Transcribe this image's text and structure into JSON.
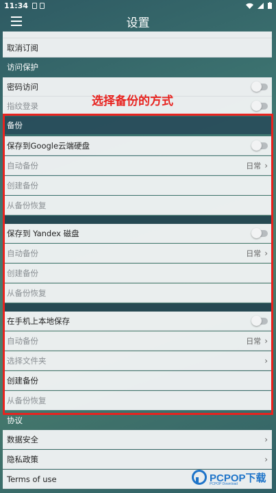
{
  "status": {
    "time": "11:34"
  },
  "app_bar": {
    "title": "设置"
  },
  "annotation": "选择备份的方式",
  "rows": {
    "cancel_subscription": "取消订阅",
    "access_header": "访问保护",
    "password_access": "密码访问",
    "fingerprint": "指纹登录",
    "backup_header": "备份",
    "google_save": "保存到Google云端硬盘",
    "auto_backup": "自动备份",
    "daily": "日常",
    "create_backup": "创建备份",
    "restore_backup": "从备份恢复",
    "yandex_save": "保存到 Yandex 磁盘",
    "local_save": "在手机上本地保存",
    "choose_folder": "选择文件夹",
    "agreement_header": "协议",
    "data_security": "数据安全",
    "privacy_policy": "隐私政策",
    "terms": "Terms of use"
  },
  "watermark": {
    "brand": "PCPOP下载",
    "sub": "PCPOP Download"
  }
}
